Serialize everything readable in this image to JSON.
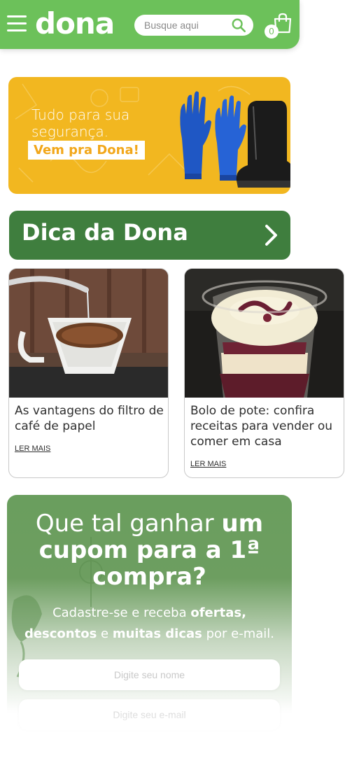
{
  "header": {
    "logo_text": "dona",
    "search_placeholder": "Busque aqui",
    "cart_count": "0",
    "icons": [
      "menu-icon",
      "search-icon",
      "shopping-bag-icon"
    ]
  },
  "banner": {
    "line1": "Tudo para sua",
    "line2": "segurança.",
    "cta": "Vem pra Dona!"
  },
  "dica": {
    "title": "Dica da Dona"
  },
  "articles": [
    {
      "title": "As vantagens do filtro de café de papel",
      "link": "LER MAIS"
    },
    {
      "title": "Bolo de pote: confira receitas para vender ou comer em casa",
      "link": "LER MAIS"
    }
  ],
  "newsletter": {
    "title_normal_1": "Que tal ganhar ",
    "title_bold_1": "um",
    "title_bold_2": "cupom para a 1ª",
    "title_bold_3": "compra?",
    "sub_part1": "Cadastre-se e receba ",
    "sub_bold1": "ofertas,",
    "sub_bold2": "descontos",
    "sub_part2": " e ",
    "sub_bold3": "muitas dicas",
    "sub_part3": " por e-mail.",
    "name_placeholder": "Digite seu nome",
    "email_placeholder": "Digite seu e-mail"
  },
  "colors": {
    "brand_green": "#6cc15a",
    "dark_green": "#3f7e3e",
    "banner_yellow": "#f2b720"
  }
}
